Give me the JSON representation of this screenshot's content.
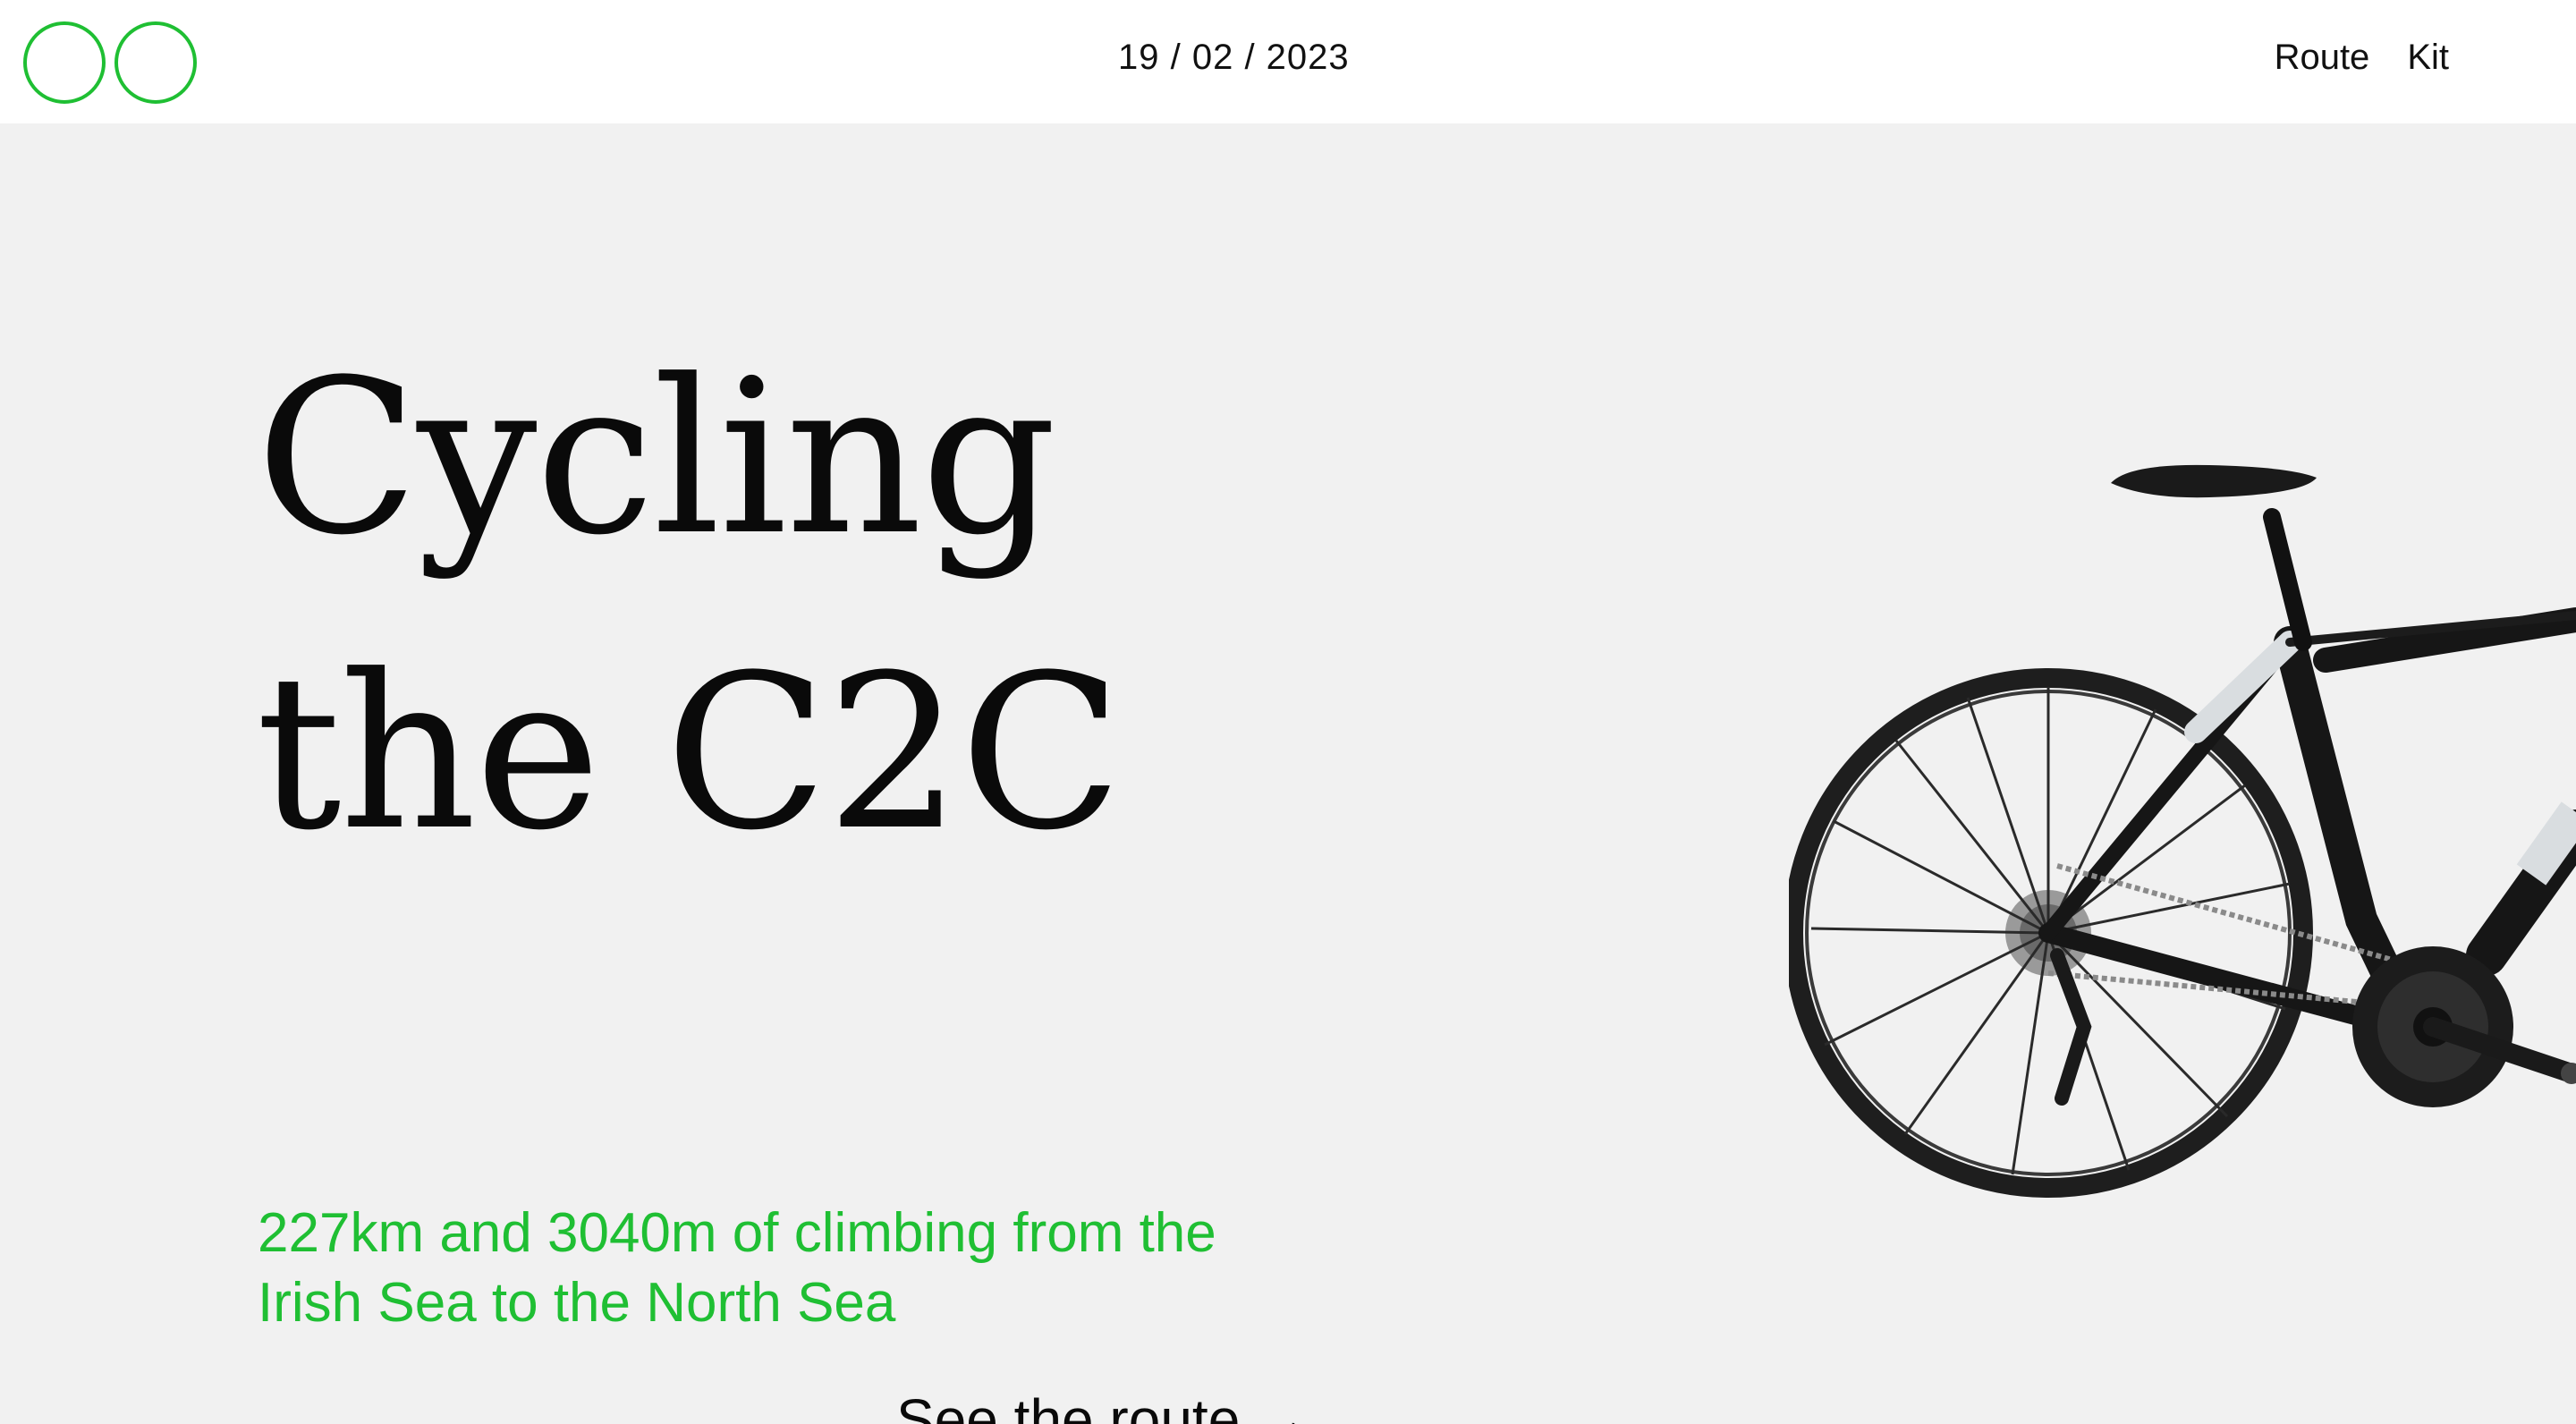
{
  "header": {
    "logo_label": "Two rings logo",
    "date": "19 / 02 / 2023",
    "nav": [
      {
        "label": "Route"
      },
      {
        "label": "Kit"
      }
    ]
  },
  "hero": {
    "title_line1": "Cycling",
    "title_line2": "the C2C",
    "subtitle_line1": "227km and 3040m of climbing from the",
    "subtitle_line2": "Irish Sea to the North Sea",
    "cta_label": "See the route →"
  },
  "icons": {
    "logo": "two-circles-logo",
    "bike": "road-bike-image"
  },
  "colors": {
    "accent": "#1fbf33",
    "hero_background": "#f1f1f1",
    "text": "#0a0a0a"
  }
}
